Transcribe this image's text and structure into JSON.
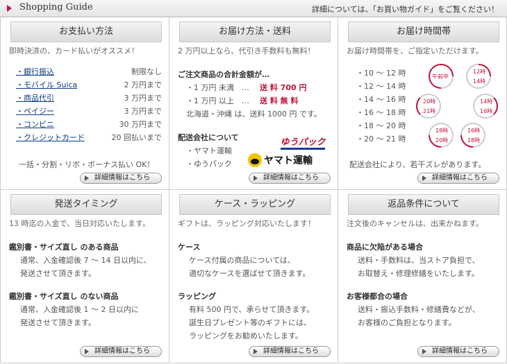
{
  "header": {
    "title": "Shopping Guide",
    "note": "詳細については、「お買い物ガイド」をご覧ください！"
  },
  "more_label": "詳細情報はこちら",
  "payment": {
    "title": "お支払い方法",
    "lead": "即時決済の、カード払いがオススメ！",
    "items": [
      {
        "name": "・銀行振込",
        "limit": "制限なし"
      },
      {
        "name": "・モバイル Suica",
        "limit": "2 万円まで"
      },
      {
        "name": "・商品代引",
        "limit": "3 万円まで"
      },
      {
        "name": "・ペイジー",
        "limit": "3 万円まで"
      },
      {
        "name": "・コンビニ",
        "limit": "30 万円まで"
      },
      {
        "name": "・クレジットカード",
        "limit": "20 回払いまで"
      }
    ],
    "foot": "一括・分割・リボ・ボーナス払い OK！"
  },
  "delivery": {
    "title": "お届け方法・送料",
    "lead": "2 万円以上なら、代引き手数料も無料！",
    "sum_label": "ご注文商品の合計金額が…",
    "row1_a": "・1 万円 未満　…",
    "row1_b": "送 料 700 円",
    "row2_a": "・1 万円 以上　…",
    "row2_b": "送 料 無 料",
    "remote": "北海道・沖縄 は、送料 1000 円 です。",
    "carrier_label": "配送会社について",
    "carriers": [
      "・ヤマト運輸",
      "・ゆうパック"
    ],
    "logo_yu": "ゆうパック",
    "logo_yamato": "ヤマト運輸"
  },
  "time": {
    "title": "お届け時間帯",
    "lead": "お届け時間帯を、ご指定いただけます。",
    "slots": [
      "・10 ～ 12 時",
      "・12 ～ 14 時",
      "・14 ～ 16 時",
      "・16 ～ 18 時",
      "・18 ～ 20 時",
      "・20 ～ 21 時"
    ],
    "clocks": [
      {
        "top": "午前中",
        "bottom": ""
      },
      {
        "top": "12時",
        "bottom": "14時"
      },
      {
        "top": "20時",
        "bottom": "21時"
      },
      {
        "top": "14時",
        "bottom": "16時"
      },
      {
        "top": "18時",
        "bottom": "20時"
      },
      {
        "top": "16時",
        "bottom": "18時"
      }
    ],
    "foot": "配送会社により、若干ズレがあります。"
  },
  "shipping": {
    "title": "発送タイミング",
    "lead": "13 時迄の入金で、当日対応いたします。",
    "a_title": "鑑別書・サイズ直し のある商品",
    "a_1": "通常、入金確認後 7 ～ 14 日以内に、",
    "a_2": "発送させて頂きます。",
    "b_title": "鑑別書・サイズ直し のない商品",
    "b_1": "通常、入金確認後 1 ～ 2 日以内に",
    "b_2": "発送させて頂きます。"
  },
  "wrapping": {
    "title": "ケース・ラッピング",
    "lead": "ギフトは、ラッピング対応いたします！",
    "a_title": "ケース",
    "a_1": "ケース付属の商品については、",
    "a_2": "適切なケースを選ばせて頂きます。",
    "b_title": "ラッピング",
    "b_1": "有料 500 円で、承らせて頂きます。",
    "b_2": "誕生日プレゼント等のギフトには、",
    "b_3": "ラッピングをお勧めいたします。"
  },
  "returns": {
    "title": "返品条件について",
    "lead": "注文後のキャンセルは、出来かねます。",
    "a_title": "商品に欠陥がある場合",
    "a_1": "送料・手数料は、当ストア負担で、",
    "a_2": "お取替え・修理修繕をいたします。",
    "b_title": "お客様都合の場合",
    "b_1": "送料・振込手数料・修繕費などが、",
    "b_2": "お客様のご負担となります。"
  },
  "colors": {
    "accent": "#c0133a",
    "link": "#0b3a82"
  }
}
